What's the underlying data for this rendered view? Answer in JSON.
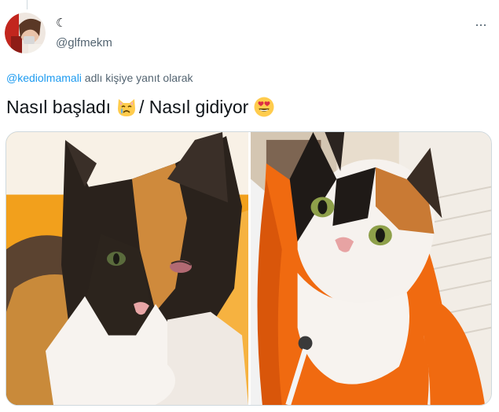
{
  "tweet": {
    "display_name_icon": "crescent-moon-icon",
    "handle": "@glfmekm",
    "more_icon": "more-horizontal-icon",
    "more_label": "···",
    "moon_glyph": "☾",
    "reply_to": {
      "mention": "@kediolmamali",
      "suffix": " adlı kişiye yanıt olarak"
    },
    "text_part1": "Nasıl başladı",
    "emoji1": "crying-cat-face-icon",
    "text_part2": "/ Nasıl gidiyor",
    "emoji2": "smiling-face-with-heart-eyes-icon"
  },
  "media": {
    "photos": [
      {
        "subject": "calico-cat-injured-eye-photo"
      },
      {
        "subject": "calico-cat-orange-hoodie-photo"
      }
    ]
  },
  "colors": {
    "text": "#0f1419",
    "secondary": "#536471",
    "link": "#1d9bf0",
    "border": "#cfd9de"
  }
}
